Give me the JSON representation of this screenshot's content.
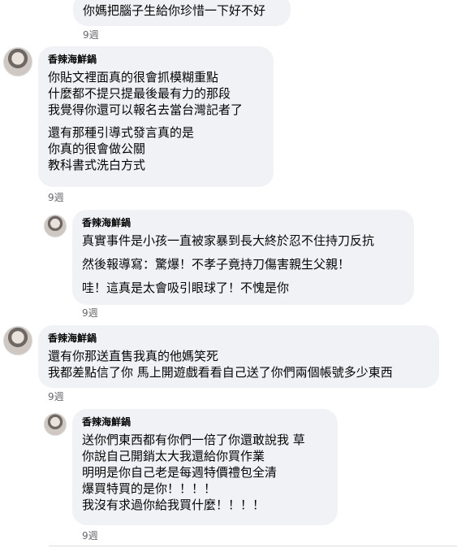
{
  "comments": [
    {
      "author": "",
      "lines": [
        "你媽把腦子生給你珍惜一下好不好"
      ],
      "time": "9週"
    },
    {
      "author": "香辣海鮮鍋",
      "lines": [
        "你貼文裡面真的很會抓模糊重點",
        "什麼都不提只提最後最有力的那段",
        "我覺得你還可以報名去當台灣記者了",
        "還有那種引導式發言真的是",
        "你真的很會做公關",
        "教科書式洗白方式"
      ],
      "time": "9週"
    },
    {
      "author": "香辣海鮮鍋",
      "lines": [
        "真實事件是小孩一直被家暴到長大終於忍不住持刀反抗",
        "然後報導寫：驚爆！不孝子竟持刀傷害親生父親！",
        "哇！這真是太會吸引眼球了！不愧是你"
      ],
      "time": "9週"
    },
    {
      "author": "香辣海鮮鍋",
      "lines": [
        "還有你那送直售我真的他媽笑死",
        "我都差點信了你 馬上開遊戲看看自己送了你們兩個帳號多少東西"
      ],
      "time": "9週"
    },
    {
      "author": "香辣海鮮鍋",
      "lines": [
        "送你們東西都有你們一倍了你還敢說我 草",
        "你說自己開銷太大我還給你買作業",
        "明明是你自己老是每週特價禮包全清",
        "爆買特買的是你！！！！",
        "我沒有求過你給我買什麼！！！！"
      ],
      "time": "9週"
    }
  ]
}
